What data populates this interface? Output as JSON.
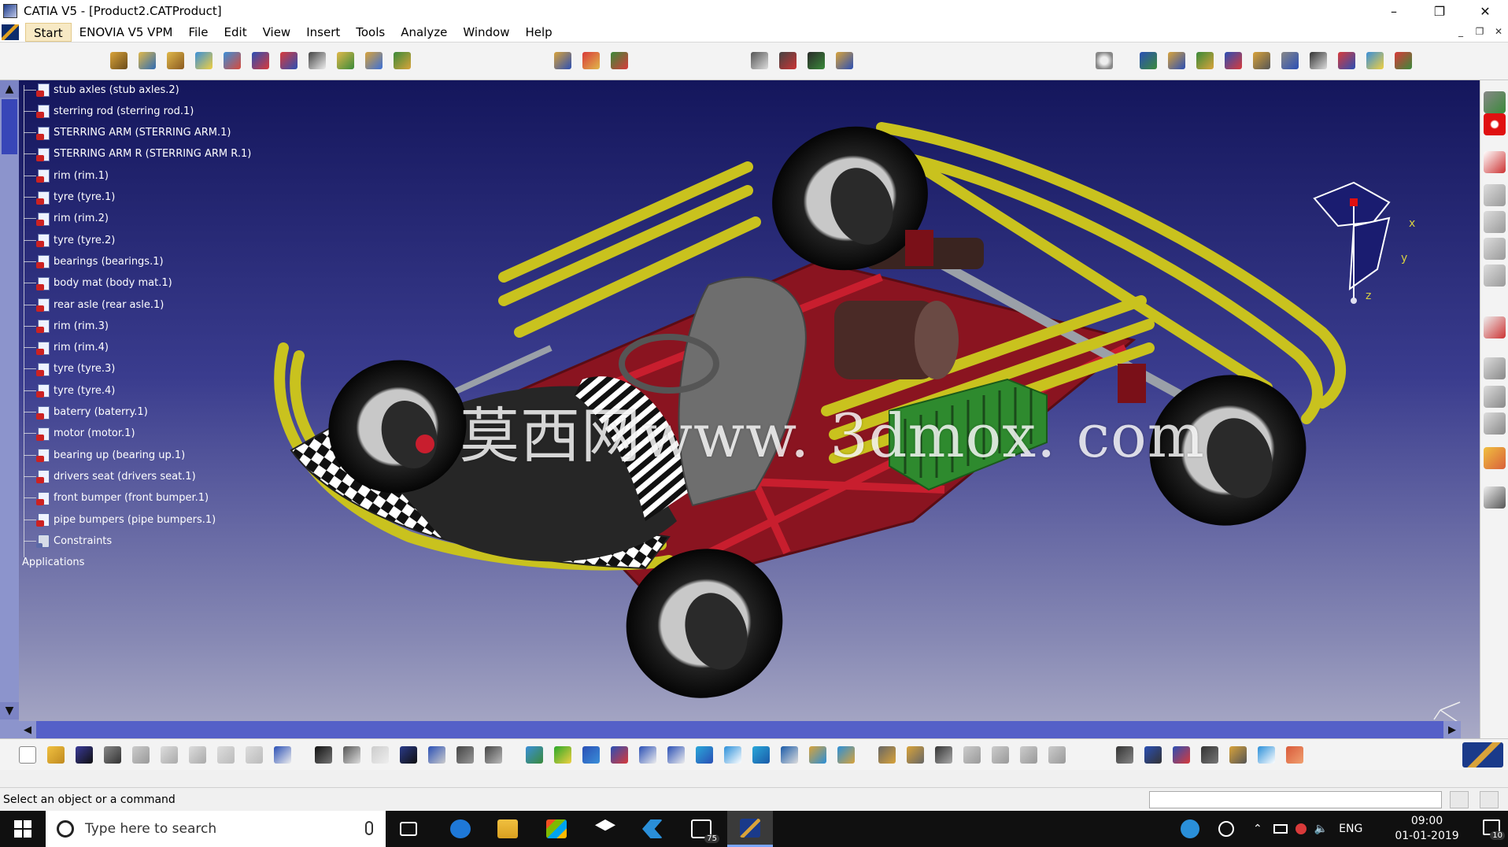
{
  "window": {
    "title": "CATIA V5 - [Product2.CATProduct]",
    "controls": {
      "minimize": "–",
      "restore": "❐",
      "close": "✕"
    }
  },
  "menu": {
    "items": [
      {
        "label": "Start"
      },
      {
        "label": "ENOVIA V5 VPM"
      },
      {
        "label": "File"
      },
      {
        "label": "Edit"
      },
      {
        "label": "View"
      },
      {
        "label": "Insert"
      },
      {
        "label": "Tools"
      },
      {
        "label": "Analyze"
      },
      {
        "label": "Window"
      },
      {
        "label": "Help"
      }
    ]
  },
  "tree": {
    "nodes": [
      {
        "label": "stub axles (stub axles.2)"
      },
      {
        "label": "sterring rod (sterring rod.1)"
      },
      {
        "label": "STERRING ARM (STERRING ARM.1)"
      },
      {
        "label": "STERRING ARM R (STERRING ARM R.1)"
      },
      {
        "label": "rim (rim.1)"
      },
      {
        "label": "tyre (tyre.1)"
      },
      {
        "label": "rim (rim.2)"
      },
      {
        "label": "tyre (tyre.2)"
      },
      {
        "label": "bearings (bearings.1)"
      },
      {
        "label": "body mat (body mat.1)"
      },
      {
        "label": "rear asle (rear asle.1)"
      },
      {
        "label": "rim (rim.3)"
      },
      {
        "label": "rim (rim.4)"
      },
      {
        "label": "tyre (tyre.3)"
      },
      {
        "label": "tyre (tyre.4)"
      },
      {
        "label": "baterry (baterry.1)"
      },
      {
        "label": "motor (motor.1)"
      },
      {
        "label": "bearing up (bearing up.1)"
      },
      {
        "label": "drivers seat (drivers seat.1)"
      },
      {
        "label": "front bumper (front bumper.1)"
      },
      {
        "label": "pipe bumpers (pipe bumpers.1)"
      },
      {
        "label": "Constraints"
      }
    ],
    "applications": "Applications"
  },
  "watermark": "莫西网www. 3dmox. com",
  "compass": {
    "x": "x",
    "y": "y",
    "z": "z"
  },
  "status": {
    "message": "Select an object or a command"
  },
  "taskbar": {
    "search_placeholder": "Type here to search",
    "mail_badge": "75",
    "language": "ENG",
    "time": "09:00",
    "date": "01-01-2019",
    "notifications": "10"
  },
  "colors": {
    "viewport_top": "#14165c",
    "viewport_bottom": "#a9aac6",
    "frame_yellow": "#c9c21e",
    "chassis_red": "#8a1420",
    "battery_green": "#2e8a2e",
    "seat_gray": "#6e6e6e"
  }
}
